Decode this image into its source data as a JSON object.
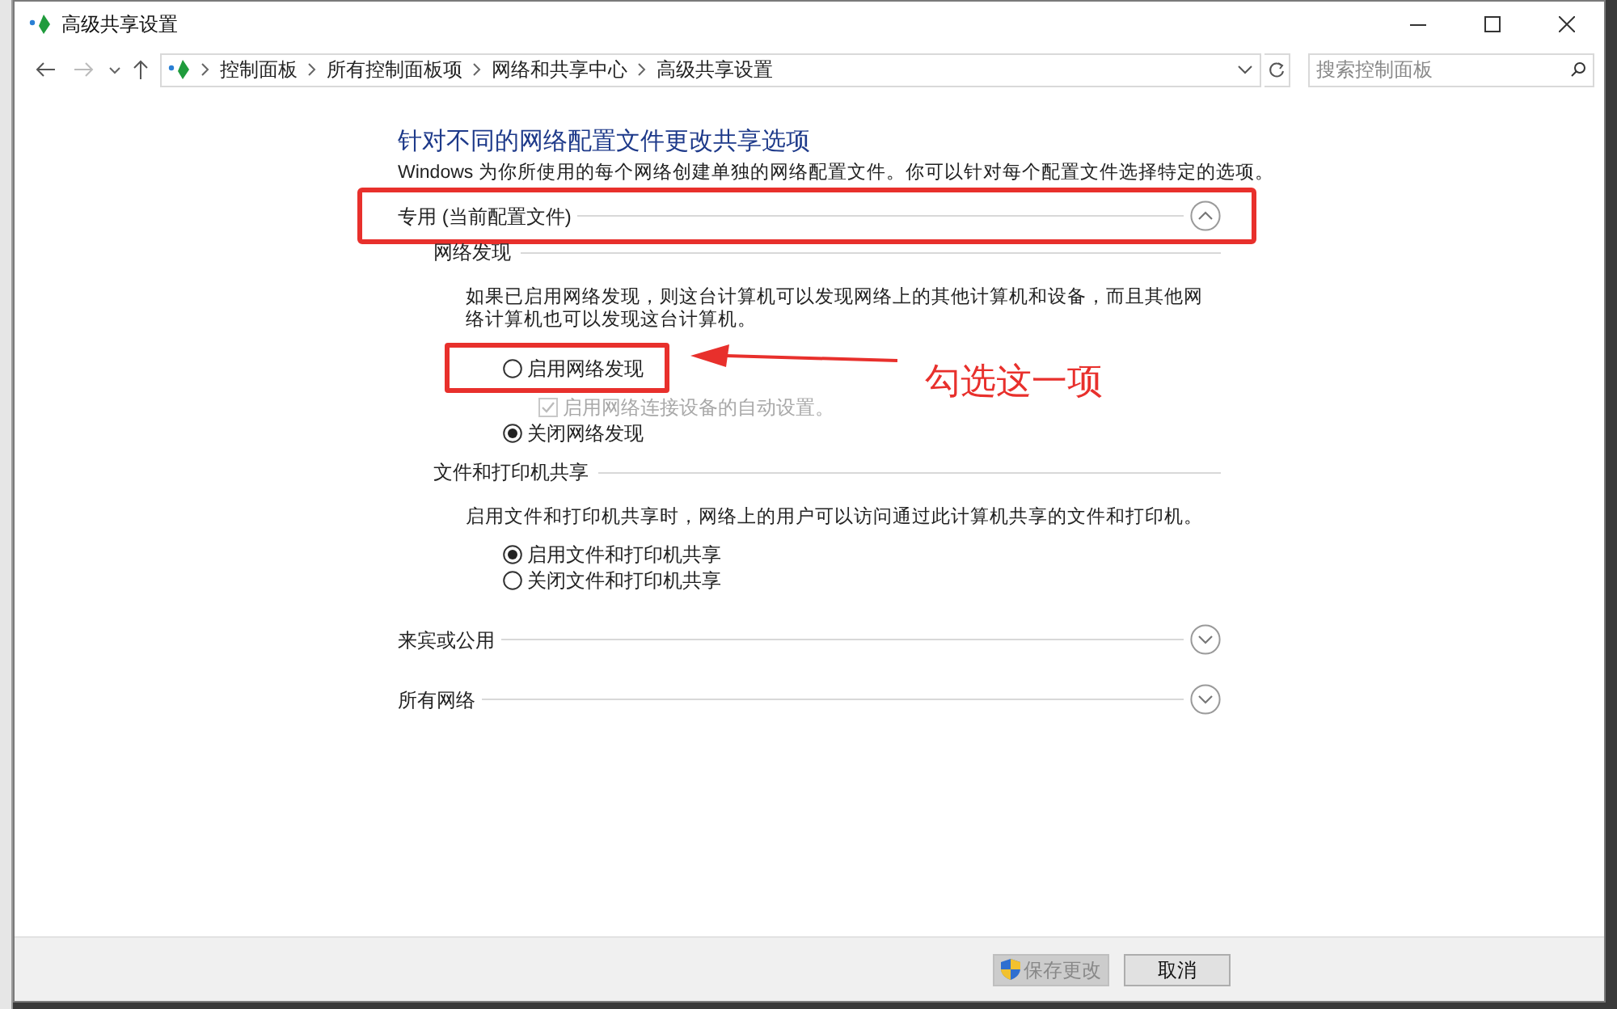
{
  "window": {
    "title": "高级共享设置"
  },
  "nav": {
    "breadcrumb": [
      "控制面板",
      "所有控制面板项",
      "网络和共享中心",
      "高级共享设置"
    ],
    "search": {
      "placeholder": "搜索控制面板"
    }
  },
  "heading": "针对不同的网络配置文件更改共享选项",
  "intro": "Windows 为你所使用的每个网络创建单独的网络配置文件。你可以针对每个配置文件选择特定的选项。",
  "profiles": [
    {
      "name": "专用 (当前配置文件)",
      "expanded": true,
      "highlighted": true,
      "sections": [
        {
          "title": "网络发现",
          "description": "如果已启用网络发现，则这台计算机可以发现网络上的其他计算机和设备，而且其他网络计算机也可以发现这台计算机。",
          "options": [
            {
              "kind": "radio",
              "label": "启用网络发现",
              "selected": false,
              "highlighted": true
            },
            {
              "kind": "checkbox",
              "label": "启用网络连接设备的自动设置。",
              "checked": true,
              "disabled": true
            },
            {
              "kind": "radio",
              "label": "关闭网络发现",
              "selected": true,
              "highlighted": false
            }
          ]
        },
        {
          "title": "文件和打印机共享",
          "description": "启用文件和打印机共享时，网络上的用户可以访问通过此计算机共享的文件和打印机。",
          "options": [
            {
              "kind": "radio",
              "label": "启用文件和打印机共享",
              "selected": true,
              "highlighted": false
            },
            {
              "kind": "radio",
              "label": "关闭文件和打印机共享",
              "selected": false,
              "highlighted": false
            }
          ]
        }
      ]
    },
    {
      "name": "来宾或公用",
      "expanded": false,
      "highlighted": false
    },
    {
      "name": "所有网络",
      "expanded": false,
      "highlighted": false
    }
  ],
  "annotation": {
    "text": "勾选这一项"
  },
  "buttons": [
    {
      "label": "保存更改",
      "disabled": true,
      "shield": true
    },
    {
      "label": "取消",
      "disabled": false,
      "shield": false
    }
  ]
}
